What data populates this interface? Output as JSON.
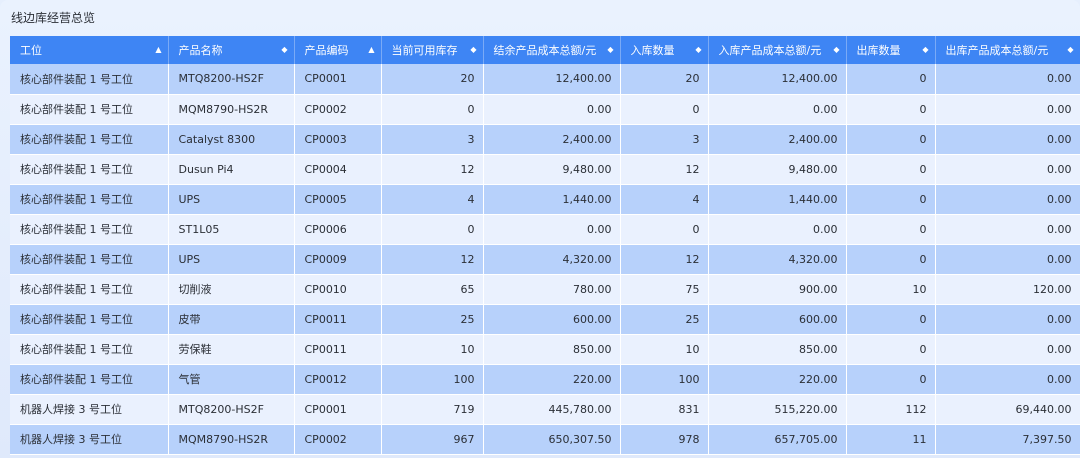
{
  "panel": {
    "title": "线边库经营总览"
  },
  "table": {
    "headers": [
      {
        "label": "工位",
        "sort": "▲"
      },
      {
        "label": "产品名称",
        "sort": "◆"
      },
      {
        "label": "产品编码",
        "sort": "▲"
      },
      {
        "label": "当前可用库存",
        "sort": "◆"
      },
      {
        "label": "结余产品成本总额/元",
        "sort": "◆"
      },
      {
        "label": "入库数量",
        "sort": "◆"
      },
      {
        "label": "入库产品成本总额/元",
        "sort": "◆"
      },
      {
        "label": "出库数量",
        "sort": "◆"
      },
      {
        "label": "出库产品成本总额/元",
        "sort": "◆"
      }
    ],
    "rows": [
      [
        "核心部件装配 1 号工位",
        "MTQ8200-HS2F",
        "CP0001",
        "20",
        "12,400.00",
        "20",
        "12,400.00",
        "0",
        "0.00"
      ],
      [
        "核心部件装配 1 号工位",
        "MQM8790-HS2R",
        "CP0002",
        "0",
        "0.00",
        "0",
        "0.00",
        "0",
        "0.00"
      ],
      [
        "核心部件装配 1 号工位",
        "Catalyst 8300",
        "CP0003",
        "3",
        "2,400.00",
        "3",
        "2,400.00",
        "0",
        "0.00"
      ],
      [
        "核心部件装配 1 号工位",
        "Dusun Pi4",
        "CP0004",
        "12",
        "9,480.00",
        "12",
        "9,480.00",
        "0",
        "0.00"
      ],
      [
        "核心部件装配 1 号工位",
        "UPS",
        "CP0005",
        "4",
        "1,440.00",
        "4",
        "1,440.00",
        "0",
        "0.00"
      ],
      [
        "核心部件装配 1 号工位",
        "ST1L05",
        "CP0006",
        "0",
        "0.00",
        "0",
        "0.00",
        "0",
        "0.00"
      ],
      [
        "核心部件装配 1 号工位",
        "UPS",
        "CP0009",
        "12",
        "4,320.00",
        "12",
        "4,320.00",
        "0",
        "0.00"
      ],
      [
        "核心部件装配 1 号工位",
        "切削液",
        "CP0010",
        "65",
        "780.00",
        "75",
        "900.00",
        "10",
        "120.00"
      ],
      [
        "核心部件装配 1 号工位",
        "皮带",
        "CP0011",
        "25",
        "600.00",
        "25",
        "600.00",
        "0",
        "0.00"
      ],
      [
        "核心部件装配 1 号工位",
        "劳保鞋",
        "CP0011",
        "10",
        "850.00",
        "10",
        "850.00",
        "0",
        "0.00"
      ],
      [
        "核心部件装配 1 号工位",
        "气管",
        "CP0012",
        "100",
        "220.00",
        "100",
        "220.00",
        "0",
        "0.00"
      ],
      [
        "机器人焊接 3 号工位",
        "MTQ8200-HS2F",
        "CP0001",
        "719",
        "445,780.00",
        "831",
        "515,220.00",
        "112",
        "69,440.00"
      ],
      [
        "机器人焊接 3 号工位",
        "MQM8790-HS2R",
        "CP0002",
        "967",
        "650,307.50",
        "978",
        "657,705.00",
        "11",
        "7,397.50"
      ]
    ]
  }
}
